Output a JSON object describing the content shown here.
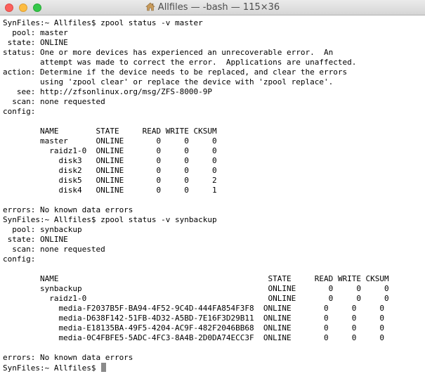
{
  "window": {
    "title": "Allfiles — -bash — 115×36",
    "icon": "home-icon"
  },
  "terminal": {
    "lines": [
      "SynFiles:~ Allfiles$ zpool status -v master",
      "  pool: master",
      " state: ONLINE",
      "status: One or more devices has experienced an unrecoverable error.  An",
      "        attempt was made to correct the error.  Applications are unaffected.",
      "action: Determine if the device needs to be replaced, and clear the errors",
      "        using 'zpool clear' or replace the device with 'zpool replace'.",
      "   see: http://zfsonlinux.org/msg/ZFS-8000-9P",
      "  scan: none requested",
      "config:",
      "",
      "        NAME        STATE     READ WRITE CKSUM",
      "        master      ONLINE       0     0     0",
      "          raidz1-0  ONLINE       0     0     0",
      "            disk3   ONLINE       0     0     0",
      "            disk2   ONLINE       0     0     0",
      "            disk5   ONLINE       0     0     2",
      "            disk4   ONLINE       0     0     1",
      "",
      "errors: No known data errors",
      "SynFiles:~ Allfiles$ zpool status -v synbackup",
      "  pool: synbackup",
      " state: ONLINE",
      "  scan: none requested",
      "config:",
      "",
      "        NAME                                             STATE     READ WRITE CKSUM",
      "        synbackup                                        ONLINE       0     0     0",
      "          raidz1-0                                       ONLINE       0     0     0",
      "            media-F2037B5F-BA94-4F52-9C4D-444FA854F3F8  ONLINE       0     0     0",
      "            media-D638F142-51FB-4D32-A5BD-7E16F3D29B11  ONLINE       0     0     0",
      "            media-E18135BA-49F5-4204-AC9F-482F2046BB68  ONLINE       0     0     0",
      "            media-0C4FBFE5-5ADC-4FC3-8A4B-2D0DA74ECC3F  ONLINE       0     0     0",
      "",
      "errors: No known data errors"
    ],
    "prompt": "SynFiles:~ Allfiles$ "
  }
}
